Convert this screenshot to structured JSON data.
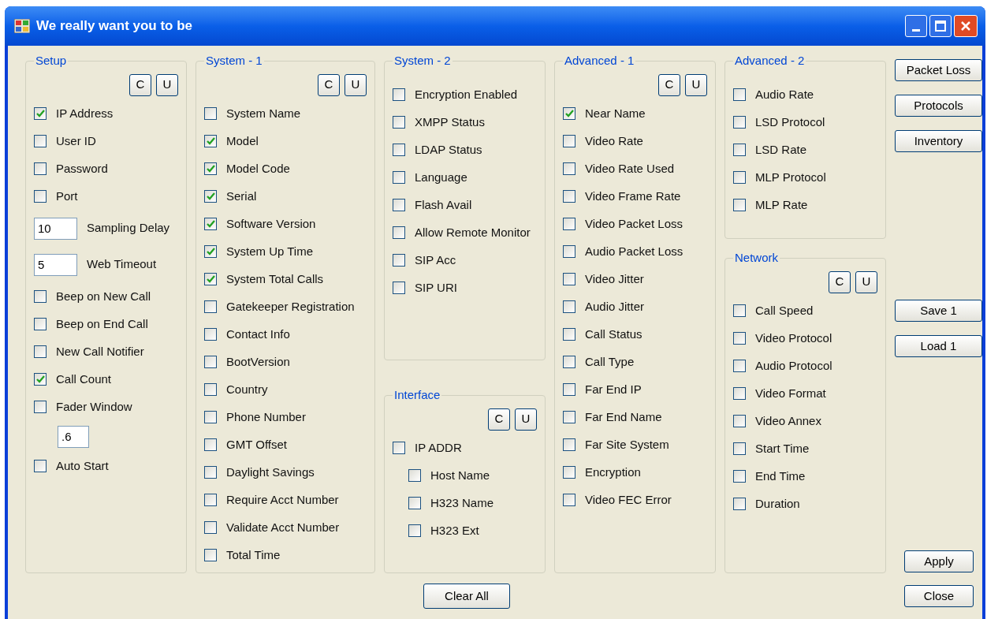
{
  "window": {
    "title": "We really want you to be"
  },
  "columns": [
    {
      "groups": [
        {
          "title": "Setup",
          "buttons": [
            "C",
            "U"
          ],
          "items": [
            {
              "kind": "checkbox",
              "label": "IP Address",
              "checked": true
            },
            {
              "kind": "checkbox",
              "label": "User ID",
              "checked": false
            },
            {
              "kind": "checkbox",
              "label": "Password",
              "checked": false
            },
            {
              "kind": "checkbox",
              "label": "Port",
              "checked": false
            },
            {
              "kind": "field",
              "value": "10",
              "caption": "Sampling Delay"
            },
            {
              "kind": "field",
              "value": "5",
              "caption": "Web Timeout"
            },
            {
              "kind": "checkbox",
              "label": "Beep on New Call",
              "checked": false
            },
            {
              "kind": "checkbox",
              "label": "Beep on End Call",
              "checked": false
            },
            {
              "kind": "checkbox",
              "label": "New Call Notifier",
              "checked": false
            },
            {
              "kind": "checkbox",
              "label": "Call Count",
              "checked": true
            },
            {
              "kind": "checkbox",
              "label": "Fader Window",
              "checked": false
            },
            {
              "kind": "subfield",
              "value": ".6"
            },
            {
              "kind": "checkbox",
              "label": "Auto Start",
              "checked": false
            }
          ]
        }
      ]
    },
    {
      "groups": [
        {
          "title": "System - 1",
          "buttons": [
            "C",
            "U"
          ],
          "items": [
            {
              "kind": "checkbox",
              "label": "System Name",
              "checked": false
            },
            {
              "kind": "checkbox",
              "label": "Model",
              "checked": true
            },
            {
              "kind": "checkbox",
              "label": "Model Code",
              "checked": true
            },
            {
              "kind": "checkbox",
              "label": "Serial",
              "checked": true
            },
            {
              "kind": "checkbox",
              "label": "Software Version",
              "checked": true
            },
            {
              "kind": "checkbox",
              "label": "System Up Time",
              "checked": true
            },
            {
              "kind": "checkbox",
              "label": "System Total Calls",
              "checked": true
            },
            {
              "kind": "checkbox",
              "label": "Gatekeeper Registration",
              "checked": false
            },
            {
              "kind": "checkbox",
              "label": "Contact Info",
              "checked": false
            },
            {
              "kind": "checkbox",
              "label": "BootVersion",
              "checked": false
            },
            {
              "kind": "checkbox",
              "label": "Country",
              "checked": false
            },
            {
              "kind": "checkbox",
              "label": "Phone Number",
              "checked": false
            },
            {
              "kind": "checkbox",
              "label": "GMT Offset",
              "checked": false
            },
            {
              "kind": "checkbox",
              "label": "Daylight Savings",
              "checked": false
            },
            {
              "kind": "checkbox",
              "label": "Require Acct Number",
              "checked": false
            },
            {
              "kind": "checkbox",
              "label": "Validate Acct Number",
              "checked": false
            },
            {
              "kind": "checkbox",
              "label": "Total Time",
              "checked": false
            }
          ]
        }
      ]
    },
    {
      "groups": [
        {
          "title": "System - 2",
          "items": [
            {
              "kind": "checkbox",
              "label": "Encryption Enabled",
              "checked": false
            },
            {
              "kind": "checkbox",
              "label": "XMPP Status",
              "checked": false
            },
            {
              "kind": "checkbox",
              "label": "LDAP Status",
              "checked": false
            },
            {
              "kind": "checkbox",
              "label": "Language",
              "checked": false
            },
            {
              "kind": "checkbox",
              "label": "Flash Avail",
              "checked": false
            },
            {
              "kind": "checkbox",
              "label": "Allow Remote Monitor",
              "checked": false
            },
            {
              "kind": "checkbox",
              "label": "SIP Acc",
              "checked": false
            },
            {
              "kind": "checkbox",
              "label": "SIP URI",
              "checked": false
            }
          ]
        },
        {
          "title": "Interface",
          "buttons": [
            "C",
            "U"
          ],
          "items": [
            {
              "kind": "checkbox",
              "label": "IP ADDR",
              "checked": false,
              "children": [
                {
                  "kind": "checkbox",
                  "label": "Host Name",
                  "checked": false
                },
                {
                  "kind": "checkbox",
                  "label": "H323 Name",
                  "checked": false
                },
                {
                  "kind": "checkbox",
                  "label": "H323 Ext",
                  "checked": false
                }
              ]
            }
          ]
        }
      ]
    },
    {
      "groups": [
        {
          "title": "Advanced - 1",
          "buttons": [
            "C",
            "U"
          ],
          "items": [
            {
              "kind": "checkbox",
              "label": "Near Name",
              "checked": true
            },
            {
              "kind": "checkbox",
              "label": "Video Rate",
              "checked": false
            },
            {
              "kind": "checkbox",
              "label": "Video Rate Used",
              "checked": false
            },
            {
              "kind": "checkbox",
              "label": "Video Frame Rate",
              "checked": false
            },
            {
              "kind": "checkbox",
              "label": "Video Packet Loss",
              "checked": false
            },
            {
              "kind": "checkbox",
              "label": "Audio Packet Loss",
              "checked": false
            },
            {
              "kind": "checkbox",
              "label": "Video Jitter",
              "checked": false
            },
            {
              "kind": "checkbox",
              "label": "Audio Jitter",
              "checked": false
            },
            {
              "kind": "checkbox",
              "label": "Call Status",
              "checked": false
            },
            {
              "kind": "checkbox",
              "label": "Call Type",
              "checked": false
            },
            {
              "kind": "checkbox",
              "label": "Far End IP",
              "checked": false
            },
            {
              "kind": "checkbox",
              "label": "Far End Name",
              "checked": false
            },
            {
              "kind": "checkbox",
              "label": "Far Site System",
              "checked": false
            },
            {
              "kind": "checkbox",
              "label": "Encryption",
              "checked": false
            },
            {
              "kind": "checkbox",
              "label": "Video FEC Error",
              "checked": false
            }
          ]
        }
      ]
    },
    {
      "groups": [
        {
          "title": "Advanced - 2",
          "items": [
            {
              "kind": "checkbox",
              "label": "Audio Rate",
              "checked": false
            },
            {
              "kind": "checkbox",
              "label": "LSD Protocol",
              "checked": false
            },
            {
              "kind": "checkbox",
              "label": "LSD Rate",
              "checked": false
            },
            {
              "kind": "checkbox",
              "label": "MLP Protocol",
              "checked": false
            },
            {
              "kind": "checkbox",
              "label": "MLP Rate",
              "checked": false
            }
          ]
        },
        {
          "title": "Network",
          "buttons": [
            "C",
            "U"
          ],
          "items": [
            {
              "kind": "checkbox",
              "label": "Call Speed",
              "checked": false
            },
            {
              "kind": "checkbox",
              "label": "Video Protocol",
              "checked": false
            },
            {
              "kind": "checkbox",
              "label": "Audio Protocol",
              "checked": false
            },
            {
              "kind": "checkbox",
              "label": "Video Format",
              "checked": false
            },
            {
              "kind": "checkbox",
              "label": "Video Annex",
              "checked": false
            },
            {
              "kind": "checkbox",
              "label": "Start Time",
              "checked": false
            },
            {
              "kind": "checkbox",
              "label": "End Time",
              "checked": false
            },
            {
              "kind": "checkbox",
              "label": "Duration",
              "checked": false
            }
          ]
        }
      ]
    }
  ],
  "side_buttons": [
    "Packet Loss",
    "Protocols",
    "Inventory",
    "Save 1",
    "Load 1",
    "Apply",
    "Close"
  ],
  "clear_button": "Clear All"
}
